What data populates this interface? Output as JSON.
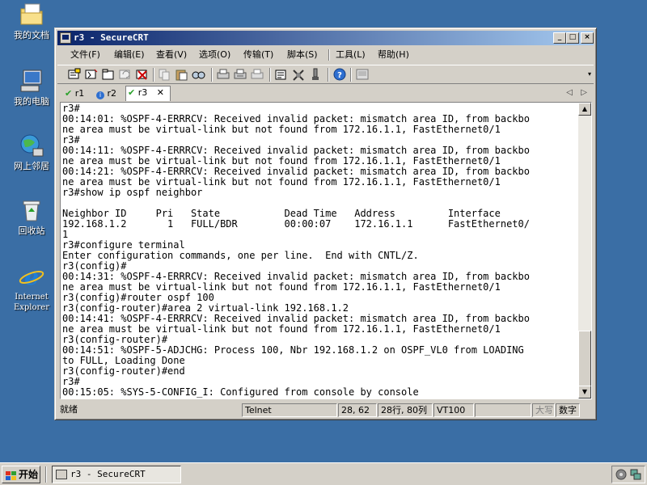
{
  "desktop": {
    "icons": [
      {
        "label": "我的文档"
      },
      {
        "label": "我的电脑"
      },
      {
        "label": "网上邻居"
      },
      {
        "label": "回收站"
      },
      {
        "label": "Internet Explorer"
      }
    ]
  },
  "window": {
    "title": "r3 - SecureCRT",
    "controls": {
      "minimize": "_",
      "maximize": "□",
      "close": "×"
    }
  },
  "menu": {
    "items": [
      "文件(F)",
      "编辑(E)",
      "查看(V)",
      "选项(O)",
      "传输(T)",
      "脚本(S)",
      "工具(L)",
      "帮助(H)"
    ]
  },
  "tabs": [
    {
      "label": "r1",
      "status": "connected"
    },
    {
      "label": "r2",
      "status": "info"
    },
    {
      "label": "r3",
      "status": "connected",
      "active": true
    }
  ],
  "terminal": {
    "lines": [
      "r3#",
      "00:14:01: %OSPF-4-ERRRCV: Received invalid packet: mismatch area ID, from backbo",
      "ne area must be virtual-link but not found from 172.16.1.1, FastEthernet0/1",
      "r3#",
      "00:14:11: %OSPF-4-ERRRCV: Received invalid packet: mismatch area ID, from backbo",
      "ne area must be virtual-link but not found from 172.16.1.1, FastEthernet0/1",
      "00:14:21: %OSPF-4-ERRRCV: Received invalid packet: mismatch area ID, from backbo",
      "ne area must be virtual-link but not found from 172.16.1.1, FastEthernet0/1",
      "r3#show ip ospf neighbor",
      "",
      "Neighbor ID     Pri   State           Dead Time   Address         Interface",
      "192.168.1.2       1   FULL/BDR        00:00:07    172.16.1.1      FastEthernet0/",
      "1",
      "r3#configure terminal",
      "Enter configuration commands, one per line.  End with CNTL/Z.",
      "r3(config)#",
      "00:14:31: %OSPF-4-ERRRCV: Received invalid packet: mismatch area ID, from backbo",
      "ne area must be virtual-link but not found from 172.16.1.1, FastEthernet0/1",
      "r3(config)#router ospf 100",
      "r3(config-router)#area 2 virtual-link 192.168.1.2",
      "00:14:41: %OSPF-4-ERRRCV: Received invalid packet: mismatch area ID, from backbo",
      "ne area must be virtual-link but not found from 172.16.1.1, FastEthernet0/1",
      "r3(config-router)#",
      "00:14:51: %OSPF-5-ADJCHG: Process 100, Nbr 192.168.1.2 on OSPF_VL0 from LOADING",
      "to FULL, Loading Done",
      "r3(config-router)#end",
      "r3#",
      "00:15:05: %SYS-5-CONFIG_I: Configured from console by console"
    ]
  },
  "status": {
    "ready": "就绪",
    "protocol": "Telnet",
    "cursor": "28, 62",
    "size": "28行, 80列",
    "emulation": "VT100",
    "caps": "大写",
    "num": "数字"
  },
  "taskbar": {
    "start": "开始",
    "task": "r3 - SecureCRT"
  }
}
